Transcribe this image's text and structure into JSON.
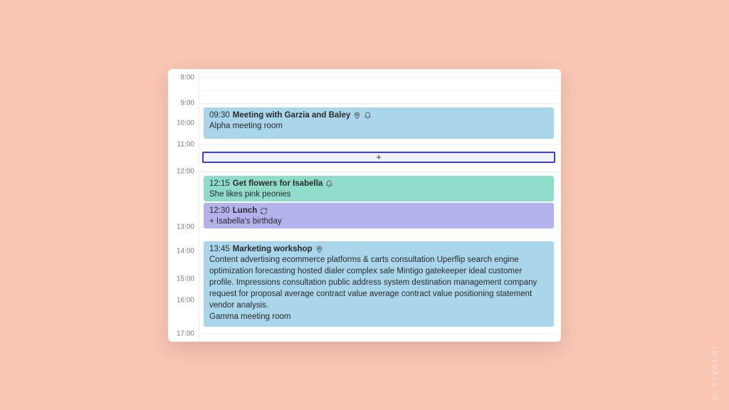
{
  "brand": "© VIVALDI",
  "hours": [
    "8:00",
    "9:00",
    "10:00",
    "11:00",
    "12:00",
    "13:00",
    "14:00",
    "15:00",
    "16:00",
    "17:00"
  ],
  "add_slot": {
    "label": "+"
  },
  "events": [
    {
      "time": "09:30",
      "title": "Meeting with Garzia and Baley",
      "location": "Alpha meeting room",
      "color": "blue",
      "has_location_icon": true,
      "has_reminder_icon": true
    },
    {
      "time": "12:15",
      "title": "Get flowers for Isabella",
      "description": "She likes pink peonies",
      "color": "teal",
      "has_reminder_icon": true
    },
    {
      "time": "12:30",
      "title": "Lunch",
      "extra": "+ Isabella's birthday",
      "color": "purple",
      "has_recurring_icon": true
    },
    {
      "time": "13:45",
      "title": "Marketing workshop",
      "description": "Content advertising ecommerce platforms & carts consultation Uperflip search engine optimization forecasting hosted dialer complex sale Mintigo gatekeeper ideal customer profile. Impressions consultation public address system destination management company request for proposal average contract value average contract value positioning statement vendor analysis.",
      "location": "Gamma meeting room",
      "color": "blue",
      "has_location_icon": true
    }
  ]
}
